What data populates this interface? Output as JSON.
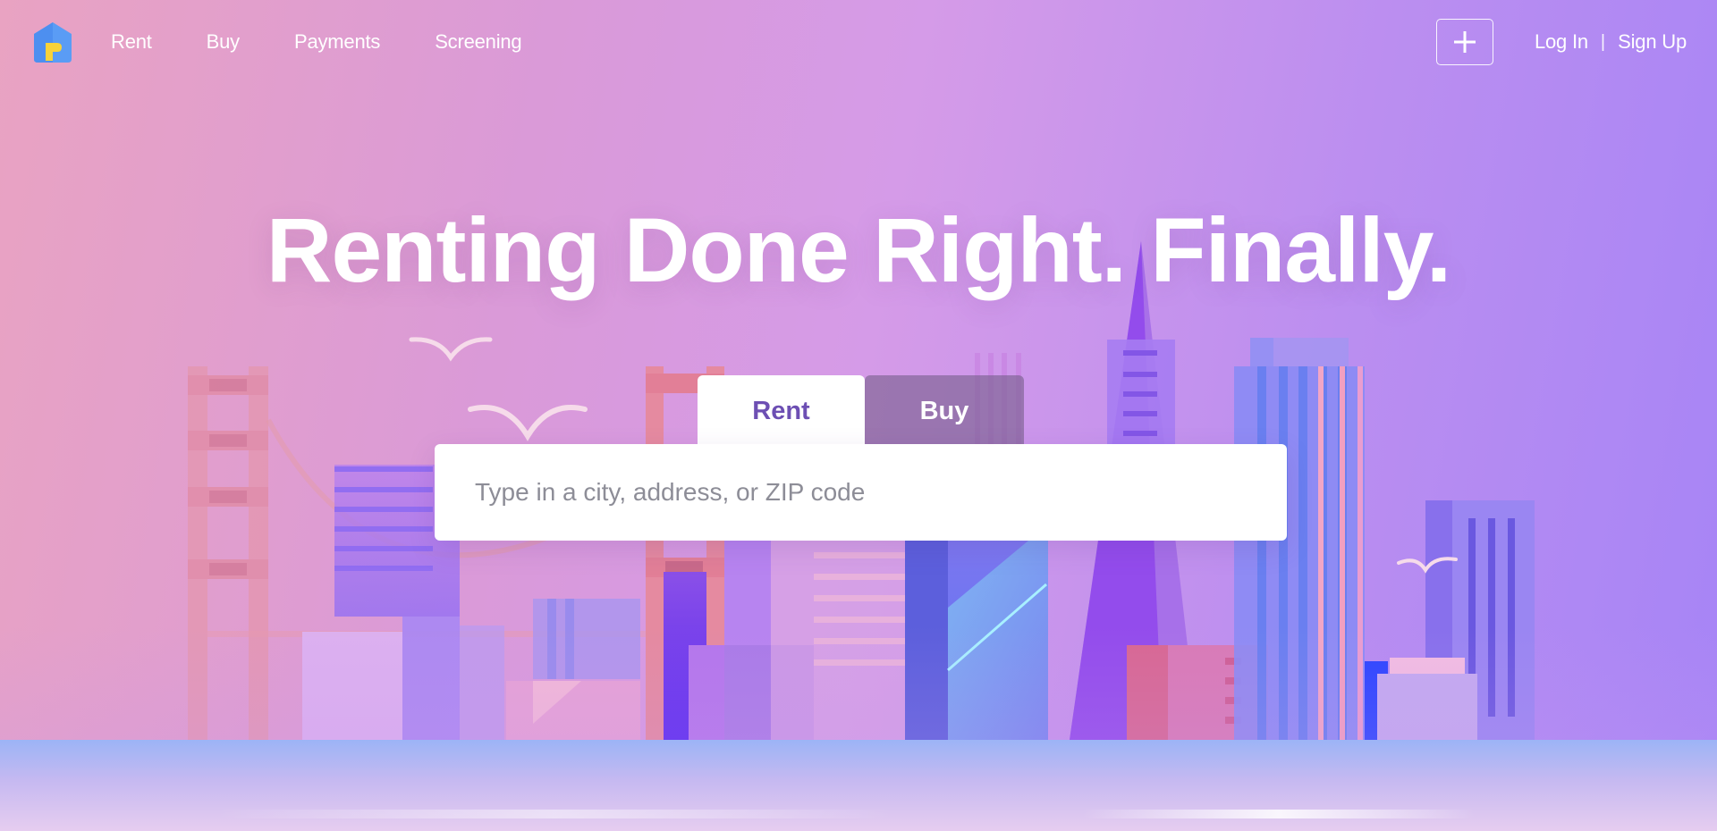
{
  "nav": {
    "logo_icon": "house-logo-icon",
    "links": [
      "Rent",
      "Buy",
      "Payments",
      "Screening"
    ],
    "add_icon": "plus-icon",
    "login": "Log In",
    "separator": "|",
    "signup": "Sign Up"
  },
  "hero": {
    "title": "Renting Done Right. Finally."
  },
  "search": {
    "tabs": [
      "Rent",
      "Buy"
    ],
    "active_tab": "Rent",
    "placeholder": "Type in a city, address, or ZIP code",
    "value": ""
  },
  "colors": {
    "accent": "#6d4fb3",
    "background_left": "#e9a3c2",
    "background_right": "#a684f6"
  }
}
